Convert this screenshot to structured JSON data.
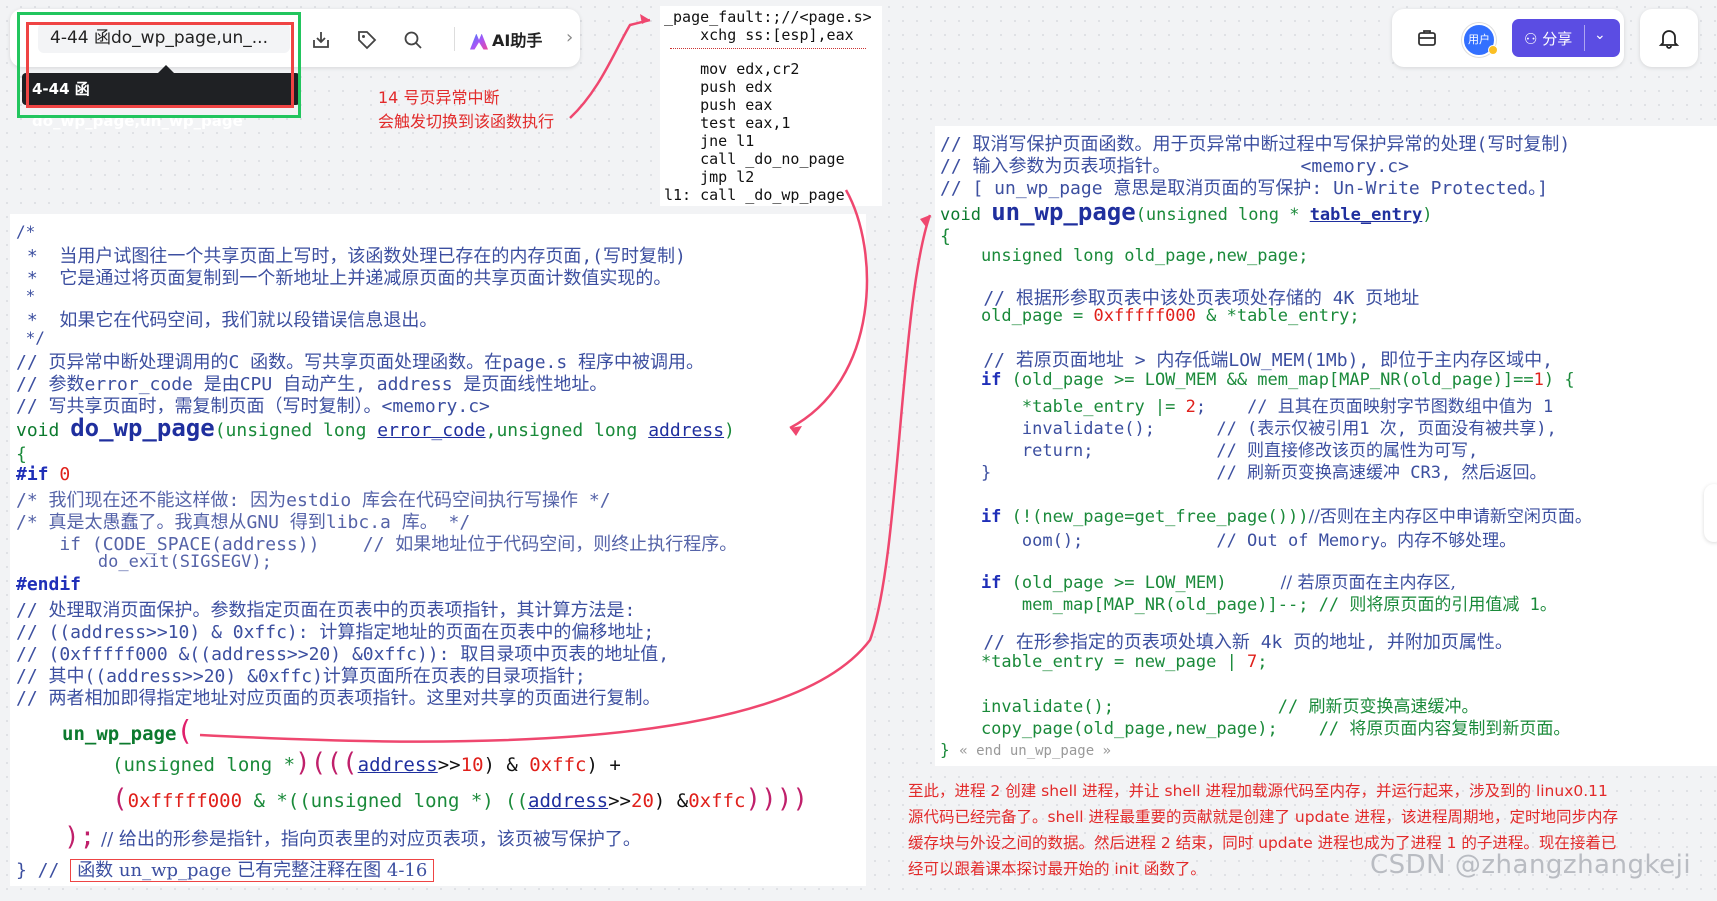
{
  "toolbar": {
    "doc_title": "4-44 函do_wp_page,un_...",
    "tooltip": "4-44  函do_wp_page,un_wp_page",
    "ai_label": "AI助手"
  },
  "right_toolbar": {
    "avatar_label": "用户",
    "share_label": "分享"
  },
  "annotation_top": {
    "line1": "14 号页异常中断",
    "line2": "会触发切换到该函数执行"
  },
  "asm": {
    "lines": [
      "_page_fault:;//<page.s>",
      "    xchg ss:[esp],eax",
      "",
      "    mov edx,cr2",
      "    push edx",
      "    push eax",
      "    test eax,1",
      "    jne l1",
      "    call _do_no_page",
      "    jmp l2",
      "l1: call _do_wp_page"
    ]
  },
  "left_code": {
    "c1": "/*",
    "c2": " *  当用户试图往一个共享页面上写时，该函数处理已存在的内存页面,(写时复制)",
    "c3": " *  它是通过将页面复制到一个新地址上并递减原页面的共享页面计数值实现的。",
    "c4": " *",
    "c5": " *  如果它在代码空间，我们就以段错误信息退出。",
    "c6": " */",
    "c7": "// 页异常中断处理调用的C 函数。写共享页面处理函数。在page.s 程序中被调用。",
    "c8": "// 参数error_code 是由CPU 自动产生, address 是页面线性地址。",
    "c9": "// 写共享页面时，需复制页面（写时复制）。<memory.c>",
    "sig_void": "void ",
    "sig_name": "do_wp_page",
    "sig_p1type": "(unsigned long ",
    "sig_p1": "error_code",
    "sig_mid": ",unsigned long ",
    "sig_p2": "address",
    "sig_end": ")",
    "brace_open": "{",
    "if0": "#if ",
    "if0_num": "0",
    "c10": "/* 我们现在还不能这样做: 因为estdio 库会在代码空间执行写操作 */",
    "c11": "/* 真是太愚蠢了。我真想从GNU 得到libc.a 库。 */",
    "c12": "    if (CODE_SPACE(address))    // 如果地址位于代码空间，则终止执行程序。",
    "c13": "        do_exit(SIGSEGV);",
    "endif": "#endif",
    "c14": "// 处理取消页面保护。参数指定页面在页表中的页表项指针，其计算方法是:",
    "c15": "// ((address>>10) & 0xffc): 计算指定地址的页面在页表中的偏移地址;",
    "c16": "// (0xfffff000 &((address>>20) &0xffc)): 取目录项中页表的地址值,",
    "c17": "// 其中((address>>20) &0xffc)计算页面所在页表的目录项指针;",
    "c18": "// 两者相加即得指定地址对应页面的页表项指针。这里对共享的页面进行复制。",
    "call_name": "un_wp_page",
    "call_l2a": "(unsigned long *",
    "call_l2b": ")(((",
    "call_l2c": "address",
    "call_l2d": ">>",
    "call_l2e": "10",
    "call_l2f": ") & ",
    "call_l2g": "0xffc",
    "call_l2h": ") +",
    "call_l3a": "(",
    "call_l3b": "0xfffff000",
    "call_l3c": " & *((unsigned long *) ((",
    "call_l3d": "address",
    "call_l3e": ">>",
    "call_l3f": "20",
    "call_l3g": ") &",
    "call_l3h": "0xffc",
    "call_l3i": "))))",
    "call_end": ");",
    "call_cmt": " // 给出的形参是指针，指向页表里的对应页表项，该页被写保护了。",
    "close": "} // ",
    "close_box": "函数 un_wp_page 已有完整注释在图 4-16"
  },
  "right_code": {
    "r1": "// 取消写保护页面函数。用于页异常中断过程中写保护异常的处理(写时复制)",
    "r2": "// 输入参数为页表项指针。            <memory.c>",
    "r3": "// [ un_wp_page 意思是取消页面的写保护: Un-Write Protected。]",
    "sig_void": "void ",
    "sig_name": "un_wp_page",
    "sig_ptype": "(unsigned long * ",
    "sig_p": "table_entry",
    "sig_end": ")",
    "brace_open": "{",
    "decl": "    unsigned long old_page,new_page;",
    "r4": "    // 根据形参取页表中该处页表项处存储的 4K 页地址",
    "r5a": "    old_page = ",
    "r5b": "0xfffff000",
    "r5c": " & *table_entry;",
    "r6": "    // 若原页面地址 > 内存低端LOW_MEM(1Mb), 即位于主内存区域中,",
    "r7a": "    if ",
    "r7b": "(old_page >= LOW_MEM && mem_map[MAP_NR(old_page)]==",
    "r7c": "1",
    "r7d": ") {",
    "r8a": "        *table_entry |= ",
    "r8b": "2",
    "r8c": ";    // 且其在页面映射字节图数组中值为 1",
    "r9": "        invalidate();      // (表示仅被引用1 次, 页面没有被共享),",
    "r10": "        return;            // 则直接修改该页的属性为可写,",
    "r11": "    }                      // 刷新页变换高速缓冲 CR3, 然后返回。",
    "r12a": "    if ",
    "r12b": "(!(new_page=get_free_page()))",
    "r12c": "//否则在主内存区中申请新空闲页面。",
    "r13": "        oom();             // Out of Memory。内存不够处理。",
    "r14a": "    if ",
    "r14b": "(old_page >= LOW_MEM)",
    "r14c": "          // 若原页面在主内存区,",
    "r15": "        mem_map[MAP_NR(old_page)]--; // 则将原页面的引用值减 1。",
    "r16": "    // 在形参指定的页表项处填入新 4k 页的地址, 并附加页属性。",
    "r17a": "    *table_entry = new_page | ",
    "r17b": "7",
    "r17c": ";",
    "r18": "    invalidate();                // 刷新页变换高速缓冲。",
    "r19": "    copy_page(old_page,new_page);    // 将原页面内容复制到新页面。",
    "close": "} ",
    "close_cmt": "« end un_wp_page »"
  },
  "annotation_bottom": {
    "line1": "至此，进程 2 创建 shell 进程，并让 shell 进程加载源代码至内存，并运行起来，涉及到的 linux0.11",
    "line2": "源代码已经完备了。shell 进程最重要的贡献就是创建了 update 进程，该进程周期地，定时地同步内存",
    "line3": "缓存块与外设之间的数据。然后进程 2 结束，同时 update 进程也成为了进程 1 的子进程。现在接着已",
    "line4": "经可以跟着课本探讨最开始的 init 函数了。"
  },
  "watermark": "CSDN @zhangzhangkeji"
}
